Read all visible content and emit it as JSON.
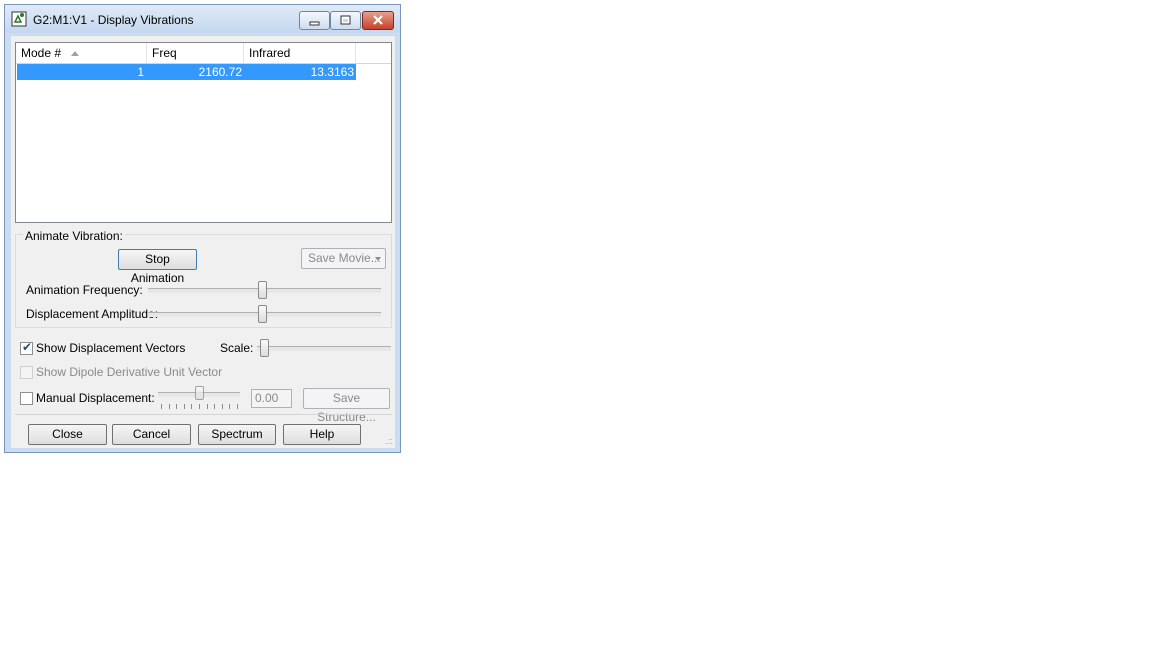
{
  "window": {
    "title": "G2:M1:V1 - Display Vibrations"
  },
  "list": {
    "columns": [
      "Mode #",
      "Freq",
      "Infrared"
    ],
    "rows": [
      {
        "mode": "1",
        "freq": "2160.72",
        "infrared": "13.3163"
      }
    ]
  },
  "animate": {
    "group_label": "Animate Vibration:",
    "stop_label": "Stop Animation",
    "save_movie_label": "Save Movie...",
    "freq_label": "Animation Frequency:",
    "amp_label": "Displacement Amplitude:",
    "freq_level": 0.49,
    "amp_level": 0.49
  },
  "options": {
    "show_vectors_label": "Show Displacement Vectors",
    "show_vectors_checked": true,
    "scale_label": "Scale:",
    "scale_level": 0.05,
    "dipole_label": "Show Dipole Derivative Unit Vector",
    "dipole_checked": false,
    "manual_label": "Manual Displacement:",
    "manual_checked": false,
    "manual_value": "0.00",
    "manual_level": 0.5,
    "save_structure_label": "Save Structure..."
  },
  "buttons": {
    "close": "Close",
    "cancel": "Cancel",
    "spectrum": "Spectrum",
    "help": "Help"
  },
  "colors": {
    "selection": "#3399ff",
    "titlebar": "#c9dcf0",
    "close_button": "#c6412a"
  }
}
